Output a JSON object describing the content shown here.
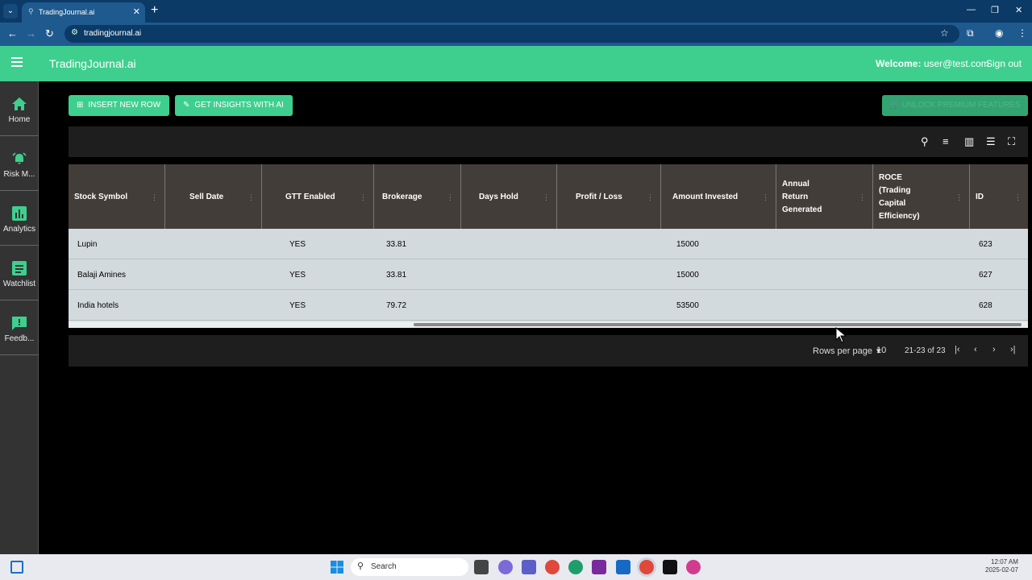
{
  "browser": {
    "tab_title": "TradingJournal.ai",
    "url": "tradingjournal.ai"
  },
  "app": {
    "brand": "TradingJournal.ai",
    "welcome_label": "Welcome:",
    "user_email": "user@test.com",
    "signout": "Sign out"
  },
  "sidebar": {
    "items": [
      {
        "label": "Home",
        "icon": "home-icon"
      },
      {
        "label": "Risk M...",
        "icon": "alarm-icon"
      },
      {
        "label": "Analytics",
        "icon": "analytics-icon"
      },
      {
        "label": "Watchlist",
        "icon": "watchlist-icon"
      },
      {
        "label": "Feedb...",
        "icon": "feedback-icon"
      }
    ]
  },
  "actions": {
    "insert": "INSERT NEW ROW",
    "insights": "GET INSIGHTS WITH AI",
    "premium": "UNLOCK PREMIUM FEATURES"
  },
  "table": {
    "columns": [
      "Stock Symbol",
      "Sell Date",
      "GTT Enabled",
      "Brokerage",
      "Days Hold",
      "Profit / Loss",
      "Amount Invested",
      "Annual Return Generated",
      "ROCE (Trading Capital Efficiency)",
      "ID"
    ],
    "rows": [
      {
        "symbol": "Lupin",
        "gtt": "YES",
        "brokerage": "33.81",
        "amount": "15000",
        "id": "623"
      },
      {
        "symbol": "Balaji Amines",
        "gtt": "YES",
        "brokerage": "33.81",
        "amount": "15000",
        "id": "627"
      },
      {
        "symbol": "India hotels",
        "gtt": "YES",
        "brokerage": "79.72",
        "amount": "53500",
        "id": "628"
      }
    ]
  },
  "pagination": {
    "rows_per_page_label": "Rows per page",
    "rows_per_page": "10",
    "range": "21-23 of 23"
  },
  "taskbar": {
    "search": "Search",
    "time": "12:07 AM",
    "date": "2025-02-07"
  },
  "colors": {
    "accent": "#3ecf8e",
    "chrome": "#1f5a8f"
  }
}
